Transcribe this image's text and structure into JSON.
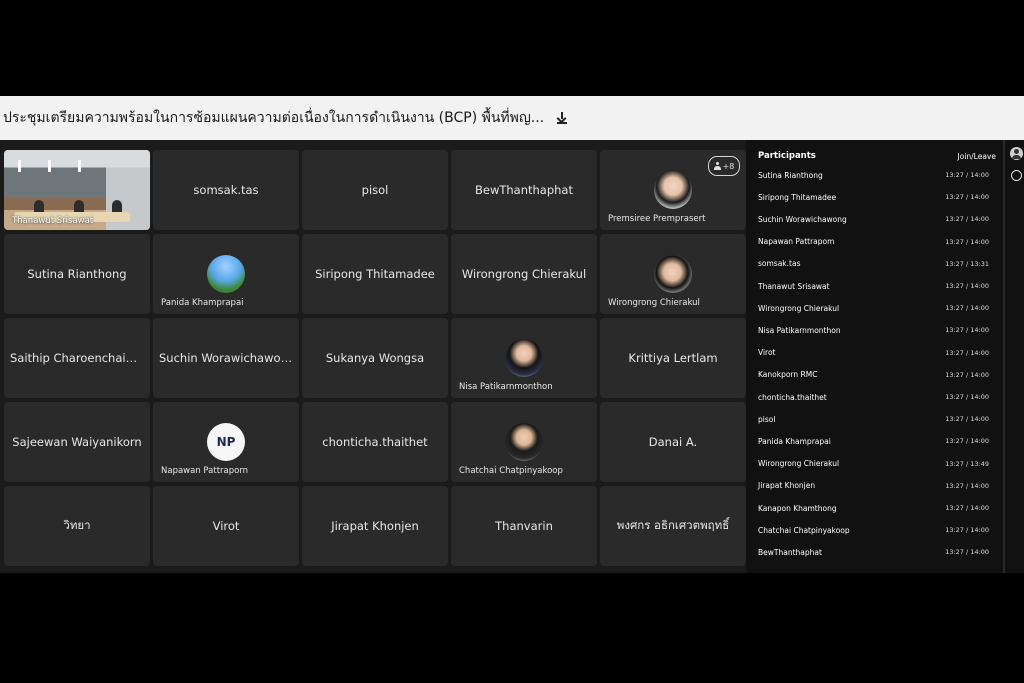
{
  "meeting": {
    "title": "ประชุมเตรียมความพร้อมในการซ้อมแผนความต่อเนื่องในการดำเนินงาน (BCP) พื้นที่พญ..."
  },
  "icons": {
    "download": "download-icon",
    "people": "people-icon",
    "chat": "chat-icon"
  },
  "grid": {
    "overflow_badge": "+8",
    "tiles": [
      {
        "type": "video",
        "caption": "Thanawut Srisawat"
      },
      {
        "type": "name",
        "label": "somsak.tas"
      },
      {
        "type": "name",
        "label": "pisol"
      },
      {
        "type": "name",
        "label": "BewThanthaphat"
      },
      {
        "type": "avatar",
        "avatar": "woman1",
        "caption": "Premsiree Premprasert"
      },
      {
        "type": "name",
        "label": "Sutina Rianthong"
      },
      {
        "type": "avatar",
        "avatar": "sky",
        "caption": "Panida Khamprapai"
      },
      {
        "type": "name",
        "label": "Siripong Thitamadee"
      },
      {
        "type": "name",
        "label": "Wirongrong Chierakul"
      },
      {
        "type": "avatar",
        "avatar": "woman2",
        "caption": "Wirongrong Chierakul"
      },
      {
        "type": "name",
        "label": "Saithip Charoenchaiwo..."
      },
      {
        "type": "name",
        "label": "Suchin Worawichawong"
      },
      {
        "type": "name",
        "label": "Sukanya Wongsa"
      },
      {
        "type": "avatar",
        "avatar": "woman3",
        "caption": "Nisa Patikarnmonthon"
      },
      {
        "type": "name",
        "label": "Krittiya Lertlam"
      },
      {
        "type": "name",
        "label": "Sajeewan Waiyanikorn"
      },
      {
        "type": "avatar",
        "avatar": "initials",
        "initials": "NP",
        "caption": "Napawan Pattraporn"
      },
      {
        "type": "name",
        "label": "chonticha.thaithet"
      },
      {
        "type": "avatar",
        "avatar": "man",
        "caption": "Chatchai Chatpinyakoop"
      },
      {
        "type": "name",
        "label": "Danai A."
      },
      {
        "type": "name",
        "label": "วิทยา"
      },
      {
        "type": "name",
        "label": "Virot"
      },
      {
        "type": "name",
        "label": "Jirapat Khonjen"
      },
      {
        "type": "name",
        "label": "Thanvarin"
      },
      {
        "type": "name",
        "label": "พงศกร อธิกเศวตพฤทธิ์"
      }
    ]
  },
  "participants_panel": {
    "title": "Participants",
    "column": "Join/Leave",
    "rows": [
      {
        "name": "Sutina Rianthong",
        "time": "13:27 / 14:00"
      },
      {
        "name": "Siripong Thitamadee",
        "time": "13:27 / 14:00"
      },
      {
        "name": "Suchin Worawichawong",
        "time": "13:27 / 14:00"
      },
      {
        "name": "Napawan Pattrapom",
        "time": "13:27 / 14:00"
      },
      {
        "name": "somsak.tas",
        "time": "13:27 / 13:31"
      },
      {
        "name": "Thanawut Srisawat",
        "time": "13:27 / 14:00"
      },
      {
        "name": "Wirongrong Chierakul",
        "time": "13:27 / 14:00"
      },
      {
        "name": "Nisa Patikarnmonthon",
        "time": "13:27 / 14:00"
      },
      {
        "name": "Virot",
        "time": "13:27 / 14:00"
      },
      {
        "name": "Kanokporn RMC",
        "time": "13:27 / 14:00"
      },
      {
        "name": "chonticha.thaithet",
        "time": "13:27 / 14:00"
      },
      {
        "name": "pisol",
        "time": "13:27 / 14:00"
      },
      {
        "name": "Panida Khamprapai",
        "time": "13:27 / 14:00"
      },
      {
        "name": "Wirongrong Chierakul",
        "time": "13:27 / 13:49"
      },
      {
        "name": "Jirapat Khonjen",
        "time": "13:27 / 14:00"
      },
      {
        "name": "Kanapon Khamthong",
        "time": "13:27 / 14:00"
      },
      {
        "name": "Chatchai Chatpinyakoop",
        "time": "13:27 / 14:00"
      },
      {
        "name": "BewThanthaphat",
        "time": "13:27 / 14:00"
      }
    ]
  }
}
